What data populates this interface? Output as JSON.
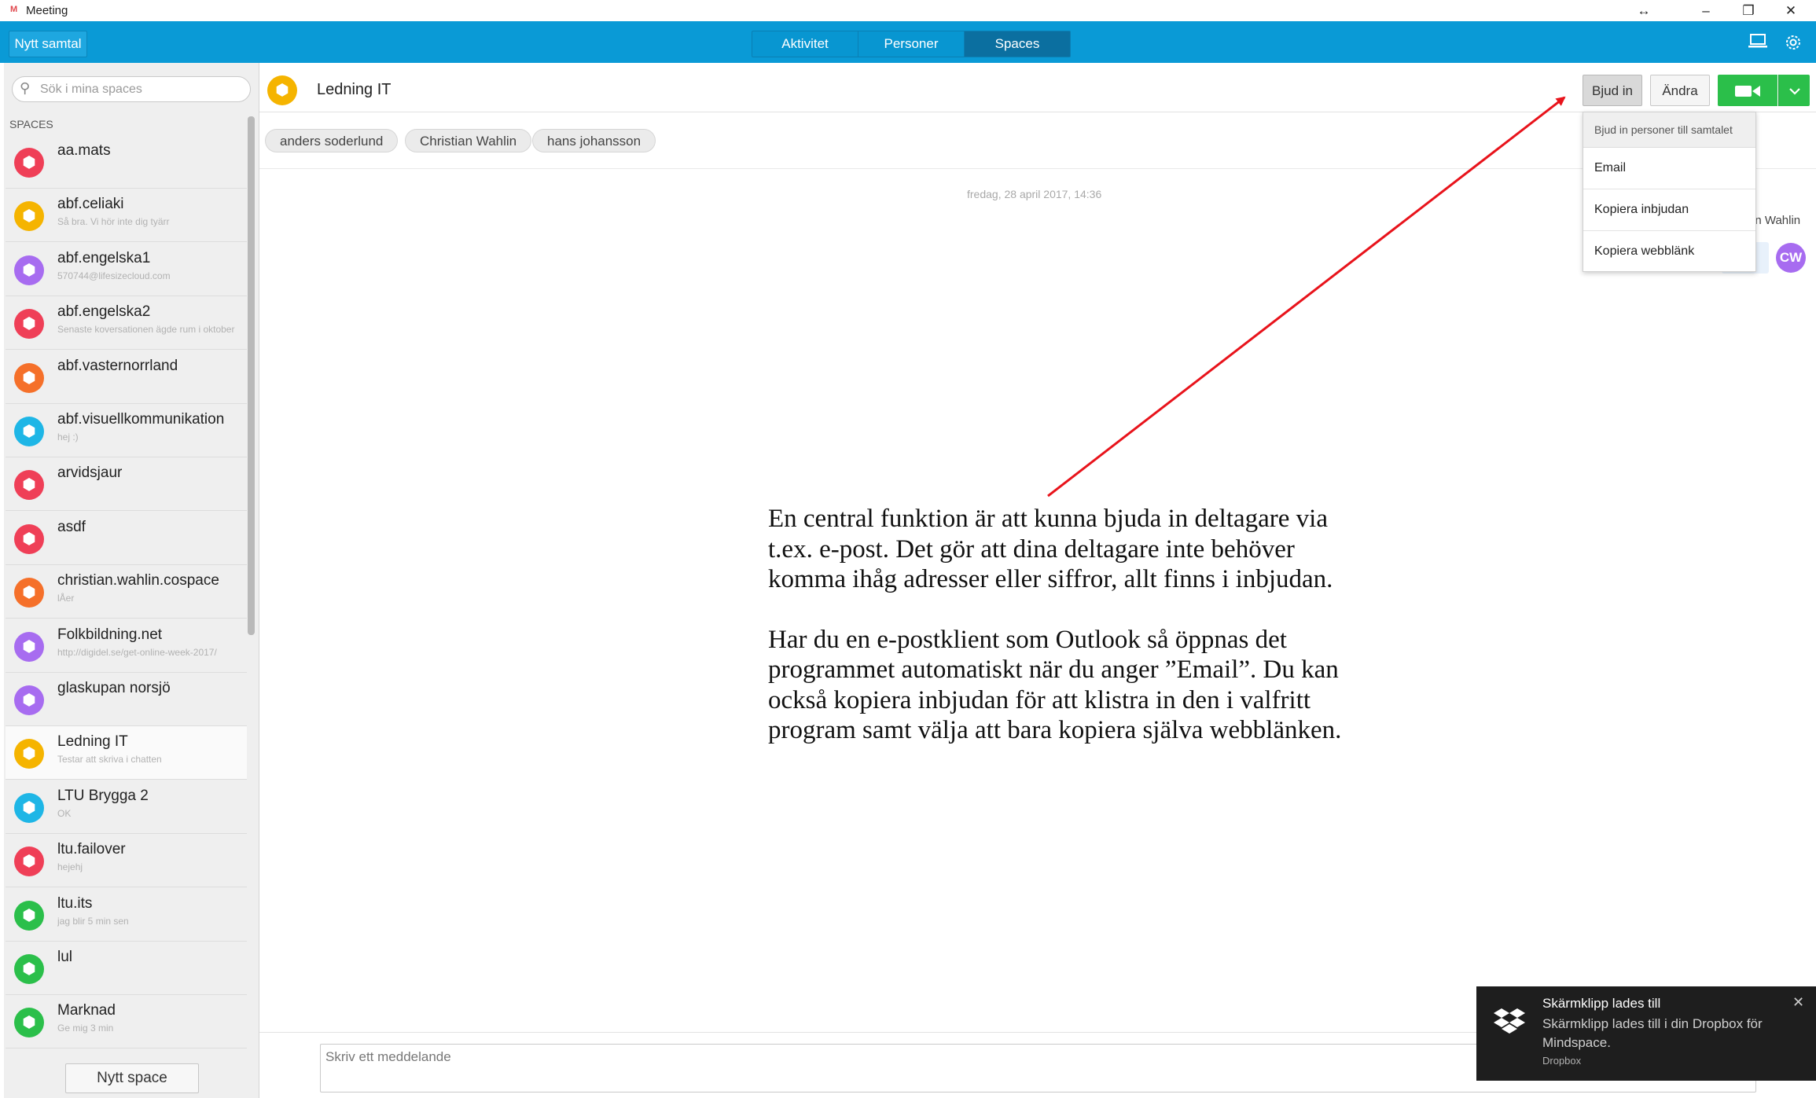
{
  "app": {
    "title": "Meeting",
    "logo": "M",
    "win_controls": [
      "↔",
      "–",
      "❐",
      "✕"
    ]
  },
  "topbar": {
    "new_call": "Nytt samtal",
    "tabs": [
      {
        "label": "Aktivitet"
      },
      {
        "label": "Personer"
      },
      {
        "label": "Spaces",
        "active": true
      }
    ],
    "icons": [
      "laptop-icon",
      "gear-icon"
    ]
  },
  "sidebar": {
    "search_placeholder": "Sök i mina spaces",
    "section_label": "SPACES",
    "spaces": [
      {
        "name": "aa.mats",
        "sub": "",
        "color": "#ef3f57"
      },
      {
        "name": "abf.celiaki",
        "sub": "Så bra. Vi hör inte dig tyärr",
        "color": "#f5b400"
      },
      {
        "name": "abf.engelska1",
        "sub": "570744@lifesizecloud.com",
        "color": "#a76cf0"
      },
      {
        "name": "abf.engelska2",
        "sub": "Senaste koversationen ägde rum i oktober",
        "color": "#ef3f57"
      },
      {
        "name": "abf.vasternorrland",
        "sub": "",
        "color": "#f5702a"
      },
      {
        "name": "abf.visuellkommunikation",
        "sub": "hej :)",
        "color": "#1eb6e6"
      },
      {
        "name": "arvidsjaur",
        "sub": "",
        "color": "#ef3f57"
      },
      {
        "name": "asdf",
        "sub": "",
        "color": "#ef3f57"
      },
      {
        "name": "christian.wahlin.cospace",
        "sub": "lÅer",
        "color": "#f5702a"
      },
      {
        "name": "Folkbildning.net",
        "sub": "http://digidel.se/get-online-week-2017/",
        "color": "#a76cf0"
      },
      {
        "name": "glaskupan norsjö",
        "sub": "",
        "color": "#a76cf0"
      },
      {
        "name": "Ledning IT",
        "sub": "Testar att skriva i chatten",
        "color": "#f5b400",
        "active": true
      },
      {
        "name": "LTU Brygga 2",
        "sub": "OK",
        "color": "#1eb6e6"
      },
      {
        "name": "ltu.failover",
        "sub": "hejehj",
        "color": "#ef3f57"
      },
      {
        "name": "ltu.its",
        "sub": "jag blir 5 min sen",
        "color": "#2bbf4a"
      },
      {
        "name": "lul",
        "sub": "",
        "color": "#2bbf4a"
      },
      {
        "name": "Marknad",
        "sub": "Ge mig 3 min",
        "color": "#2bbf4a"
      }
    ],
    "new_space": "Nytt space"
  },
  "main": {
    "room_title": "Ledning IT",
    "participants": [
      "anders soderlund",
      "Christian Wahlin",
      "hans johansson"
    ],
    "timestamp": "fredag, 28 april 2017, 14:36",
    "partial_sender": "an Wahlin",
    "sender_initials": "CW",
    "compose_placeholder": "Skriv ett meddelande"
  },
  "actions": {
    "invite": "Bjud in",
    "change": "Ändra",
    "video_icon": "video-camera-icon",
    "menu_header": "Bjud in personer till samtalet",
    "menu_items": [
      "Email",
      "Kopiera inbjudan",
      "Kopiera webblänk"
    ]
  },
  "annotation": {
    "paragraphs": [
      "En central funktion är att kunna bjuda in deltagare via t.ex. e-post. Det gör att dina deltagare inte behöver komma ihåg adresser eller siffror, allt finns i inbjudan.",
      "Har du en e-postklient som Outlook så öppnas det programmet automatiskt när du anger ”Email”. Du kan också kopiera inbjudan för att klistra in den i valfritt program samt välja att bara kopiera själva webblänken."
    ],
    "arrow_color": "#e8131b"
  },
  "toast": {
    "title": "Skärmklipp lades till",
    "body": "Skärmklipp lades till i din Dropbox för Mindspace.",
    "source": "Dropbox"
  }
}
